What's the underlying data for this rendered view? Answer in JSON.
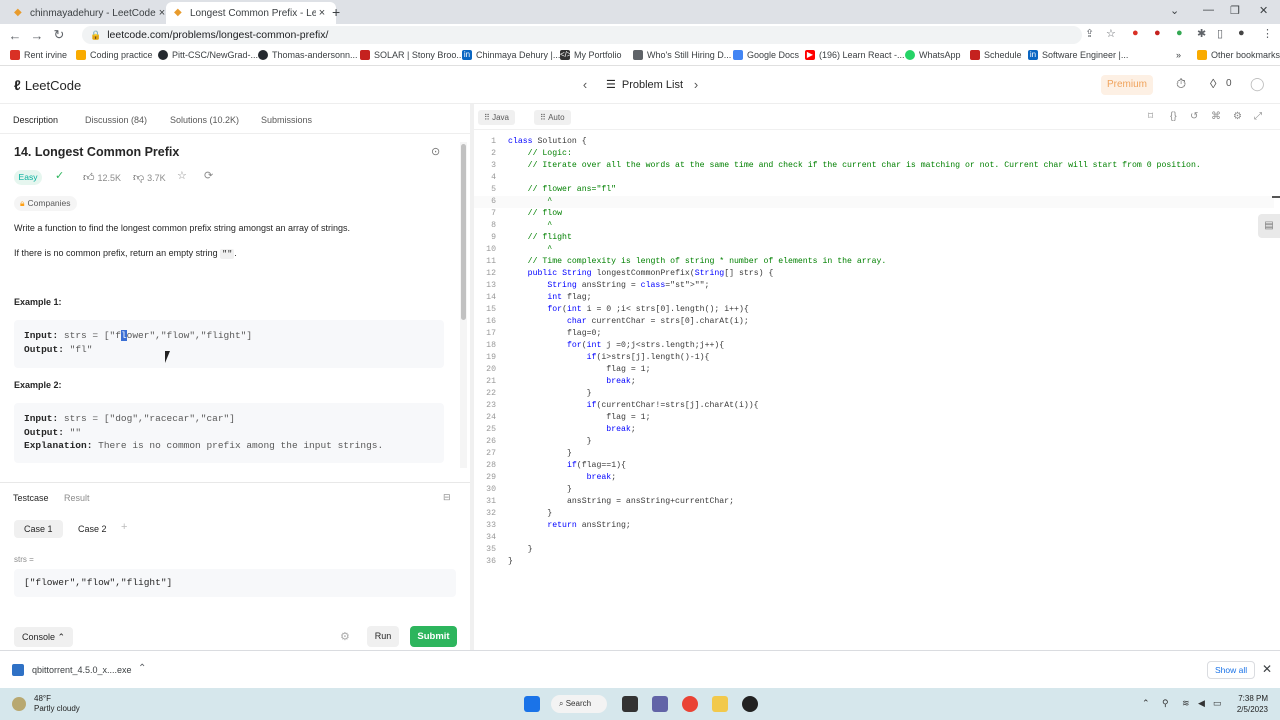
{
  "browser": {
    "tabs": [
      {
        "title": "chinmayadehury - LeetCode Pro",
        "active": false
      },
      {
        "title": "Longest Common Prefix - LeetCo",
        "active": true
      }
    ],
    "url": "leetcode.com/problems/longest-common-prefix/",
    "bookmarks": [
      {
        "label": "Rent irvine",
        "color": "#d93025"
      },
      {
        "label": "Coding practice",
        "color": "#f9ab00"
      },
      {
        "label": "Pitt-CSC/NewGrad-...",
        "color": "#24292f"
      },
      {
        "label": "Thomas-andersonn...",
        "color": "#24292f"
      },
      {
        "label": "SOLAR | Stony Broo...",
        "color": "#c5221f"
      },
      {
        "label": "Chinmaya Dehury |...",
        "color": "#0a66c2"
      },
      {
        "label": "My Portfolio",
        "color": "#333333"
      },
      {
        "label": "Who's Still Hiring D...",
        "color": "#5f6368"
      },
      {
        "label": "Google Docs",
        "color": "#4285f4"
      },
      {
        "label": "(196) Learn React -...",
        "color": "#ff0000"
      },
      {
        "label": "WhatsApp",
        "color": "#25d366"
      },
      {
        "label": "Schedule",
        "color": "#c5221f"
      },
      {
        "label": "Software Engineer |...",
        "color": "#0a66c2"
      },
      {
        "label": "Other bookmarks",
        "color": "#f9ab00"
      }
    ]
  },
  "header": {
    "logo": "LeetCode",
    "problem_list": "Problem List",
    "premium": "Premium",
    "fire_count": "0"
  },
  "description": {
    "tabs": [
      "Description",
      "Discussion (84)",
      "Solutions (10.2K)",
      "Submissions"
    ],
    "title": "14. Longest Common Prefix",
    "difficulty": "Easy",
    "likes": "12.5K",
    "dislikes": "3.7K",
    "companies": "Companies",
    "para1": "Write a function to find the longest common prefix string amongst an array of strings.",
    "para2_pre": "If there is no common prefix, return an empty string ",
    "para2_code": "\"\"",
    "para2_post": ".",
    "example1": {
      "title": "Example 1:",
      "input_label": "Input:",
      "input_pre": "strs = [\"f",
      "input_hl": "l",
      "input_post": "ower\",\"flow\",\"flight\"]",
      "output_label": "Output:",
      "output": "\"fl\""
    },
    "example2": {
      "title": "Example 2:",
      "input_label": "Input:",
      "input": "strs = [\"dog\",\"racecar\",\"car\"]",
      "output_label": "Output:",
      "output": "\"\"",
      "explanation_label": "Explanation:",
      "explanation": "There is no common prefix among the input strings."
    }
  },
  "testcase": {
    "tabs": [
      "Testcase",
      "Result"
    ],
    "cases": [
      "Case 1",
      "Case 2"
    ],
    "add": "+",
    "param_label": "strs =",
    "value": "[\"flower\",\"flow\",\"flight\"]",
    "console": "Console",
    "run": "Run",
    "submit": "Submit"
  },
  "editor": {
    "language": "Java",
    "mode": "Auto",
    "code": [
      "class Solution {",
      "    // Logic:",
      "    // Iterate over all the words at the same time and check if the current char is matching or not. Current char will start from 0 position.",
      "",
      "    // flower ans=\"fl\"",
      "        ^",
      "    // flow",
      "        ^",
      "    // flight",
      "        ^",
      "    // Time complexity is length of string * number of elements in the array.",
      "    public String longestCommonPrefix(String[] strs) {",
      "        String ansString = \"\";",
      "        int flag;",
      "        for(int i = 0 ;i< strs[0].length(); i++){",
      "            char currentChar = strs[0].charAt(i);",
      "            flag=0;",
      "            for(int j =0;j<strs.length;j++){",
      "                if(i>strs[j].length()-1){",
      "                    flag = 1;",
      "                    break;",
      "                }",
      "                if(currentChar!=strs[j].charAt(i)){",
      "                    flag = 1;",
      "                    break;",
      "                }",
      "            }",
      "            if(flag==1){",
      "                break;",
      "            }",
      "            ansString = ansString+currentChar;",
      "        }",
      "        return ansString;",
      "",
      "    }",
      "}"
    ]
  },
  "download": {
    "filename": "qbittorrent_4.5.0_x....exe",
    "show_all": "Show all"
  },
  "taskbar": {
    "temperature": "48°F",
    "weather": "Partly cloudy",
    "search": "Search",
    "time": "7:38 PM",
    "date": "2/5/2023"
  }
}
